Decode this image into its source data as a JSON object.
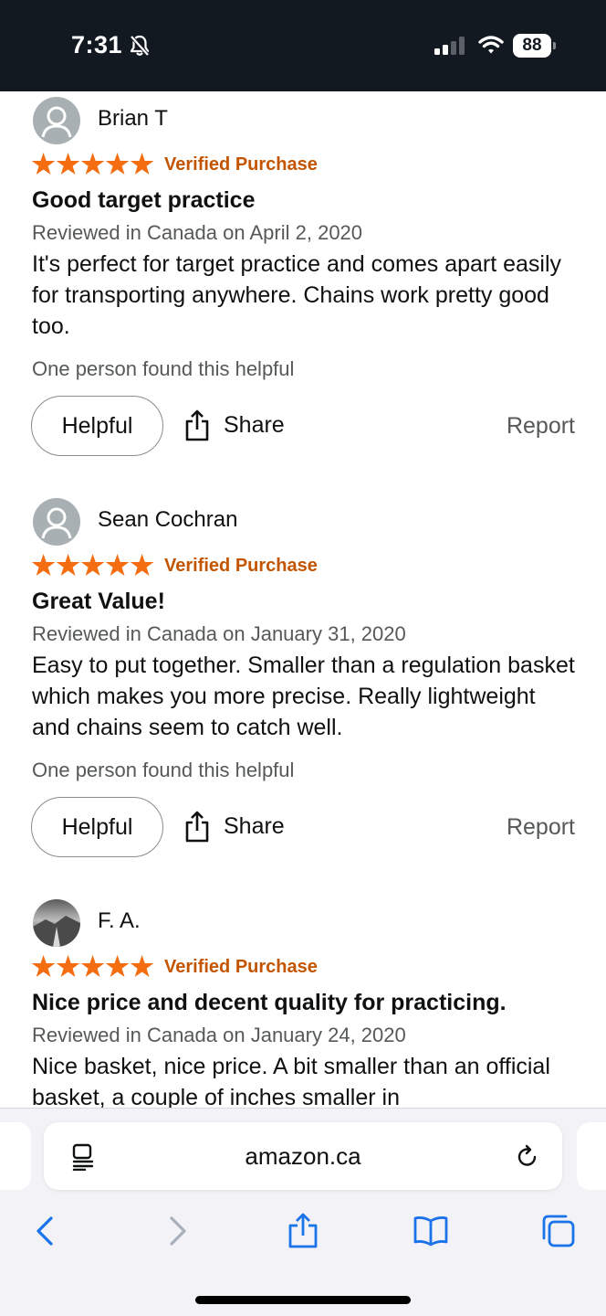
{
  "status_bar": {
    "time": "7:31",
    "battery": "88",
    "icons": [
      "bell-slash-icon",
      "cellular-signal-icon",
      "wifi-icon",
      "battery-icon"
    ]
  },
  "reviews": [
    {
      "reviewer": "Brian T",
      "rating": 5,
      "verified": "Verified Purchase",
      "title": "Good target practice",
      "date": "Reviewed in Canada on April 2, 2020",
      "body": "It's perfect for target practice and comes apart easily for transporting anywhere. Chains work pretty good too.",
      "helpful_count": "One person found this helpful",
      "helpful_label": "Helpful",
      "share_label": "Share",
      "report_label": "Report"
    },
    {
      "reviewer": "Sean Cochran",
      "rating": 5,
      "verified": "Verified Purchase",
      "title": "Great Value!",
      "date": "Reviewed in Canada on January 31, 2020",
      "body": "Easy to put together. Smaller than a regulation basket which makes you more precise. Really lightweight and chains seem to catch well.",
      "helpful_count": "One person found this helpful",
      "helpful_label": "Helpful",
      "share_label": "Share",
      "report_label": "Report"
    },
    {
      "reviewer": "F. A.",
      "rating": 5,
      "verified": "Verified Purchase",
      "title": "Nice price and decent quality for practicing.",
      "date": "Reviewed in Canada on January 24, 2020",
      "body": "Nice basket, nice price. A bit smaller than an official basket, a couple of inches smaller in",
      "helpful_count": "",
      "helpful_label": "",
      "share_label": "",
      "report_label": ""
    }
  ],
  "browser": {
    "url": "amazon.ca",
    "toolbar": [
      "back-icon",
      "forward-icon",
      "share-icon",
      "bookmarks-icon",
      "tabs-icon"
    ]
  },
  "colors": {
    "status_bar_bg": "#131921",
    "star": "#f46d10",
    "verified": "#c45500",
    "link_blue": "#1a73e8"
  }
}
